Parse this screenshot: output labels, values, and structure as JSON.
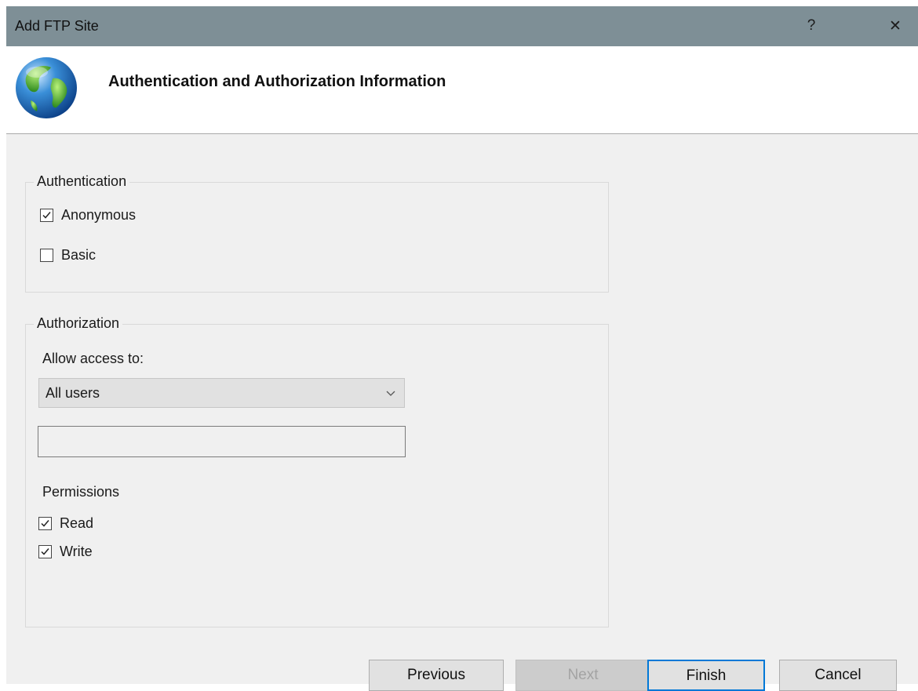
{
  "window": {
    "title": "Add FTP Site",
    "help_label": "?",
    "close_label": "✕"
  },
  "header": {
    "title": "Authentication and Authorization Information",
    "icon": "globe-icon"
  },
  "authentication": {
    "legend": "Authentication",
    "options": [
      {
        "label": "Anonymous",
        "checked": true
      },
      {
        "label": "Basic",
        "checked": false
      }
    ]
  },
  "authorization": {
    "legend": "Authorization",
    "allow_access_label": "Allow access to:",
    "allow_access_value": "All users",
    "users_input_value": "",
    "permissions_label": "Permissions",
    "permissions": [
      {
        "label": "Read",
        "checked": true
      },
      {
        "label": "Write",
        "checked": true
      }
    ]
  },
  "buttons": {
    "previous": "Previous",
    "next": "Next",
    "finish": "Finish",
    "cancel": "Cancel"
  },
  "colors": {
    "titlebar": "#7e8f96",
    "content_bg": "#f0f0f0",
    "default_button_border": "#0078d7"
  }
}
